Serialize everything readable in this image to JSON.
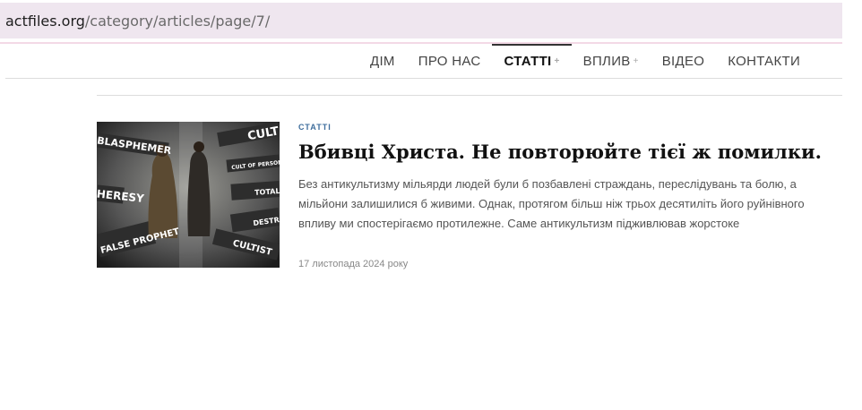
{
  "browser": {
    "url_host": "actfiles.org",
    "url_path": "/category/articles/page/7/"
  },
  "nav": {
    "items": [
      {
        "label": "ДІМ"
      },
      {
        "label": "ПРО НАС"
      },
      {
        "label": "СТАТТІ"
      },
      {
        "label": "ВПЛИВ"
      },
      {
        "label": "ВІДЕО"
      },
      {
        "label": "КОНТАКТИ"
      }
    ],
    "dropdown_marker": "+"
  },
  "article": {
    "category": "СТАТТІ",
    "title": "Вбивці Христа. Не повторюйте тієї ж помилки.",
    "excerpt": "Без антикультизму мільярди людей були б позбавлені страждань, переслідувань та болю, а мільйони залишилися б живими. Однак, протягом більш ніж трьох десятиліть його руйнівного впливу ми спостерігаємо протилежне. Саме антикультизм підживлював жорстоке",
    "date": "17 листопада 2024 року",
    "image_words": [
      "BLASPHEMER",
      "CULT",
      "CULT OF PERSONALITY",
      "HERESY",
      "TOTALITARIAN CULT",
      "DESTRUCTIVE CULT",
      "FALSE PROPHET",
      "CULTIST"
    ]
  },
  "colors": {
    "url_bar_bg": "#efe6ef",
    "category_blue": "#3e6d9c",
    "active_nav_underline": "#333333"
  }
}
